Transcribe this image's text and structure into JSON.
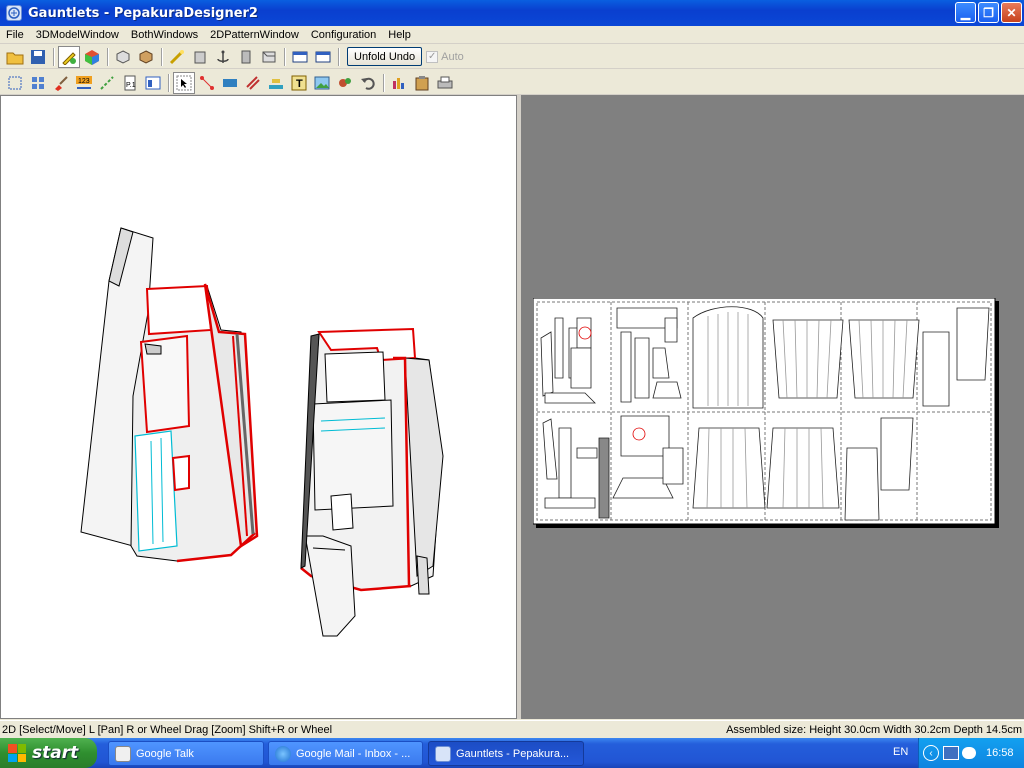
{
  "window": {
    "title": "Gauntlets - PepakuraDesigner2"
  },
  "menu": [
    "File",
    "3DModelWindow",
    "BothWindows",
    "2DPatternWindow",
    "Configuration",
    "Help"
  ],
  "toolbar": {
    "unfold_undo_label": "Unfold Undo",
    "auto_label": "Auto",
    "auto_checked": true
  },
  "status": {
    "left": "2D [Select/Move] L [Pan] R or Wheel Drag [Zoom] Shift+R or Wheel",
    "right": "Assembled size: Height 30.0cm Width 30.2cm Depth 14.5cm"
  },
  "taskbar": {
    "start_label": "start",
    "tasks": [
      {
        "label": "Google Talk",
        "icon": "chat-bubble-icon"
      },
      {
        "label": "Google Mail - Inbox - ...",
        "icon": "ie-browser-icon"
      },
      {
        "label": "Gauntlets - Pepakura...",
        "icon": "pepakura-app-icon",
        "active": true
      }
    ],
    "language": "EN",
    "clock": "16:58"
  },
  "colors": {
    "accent_titlebar": "#0a47d6",
    "model_edge": "#e00000",
    "model_fold": "#00bcd4",
    "pattern_bg": "#808080"
  }
}
